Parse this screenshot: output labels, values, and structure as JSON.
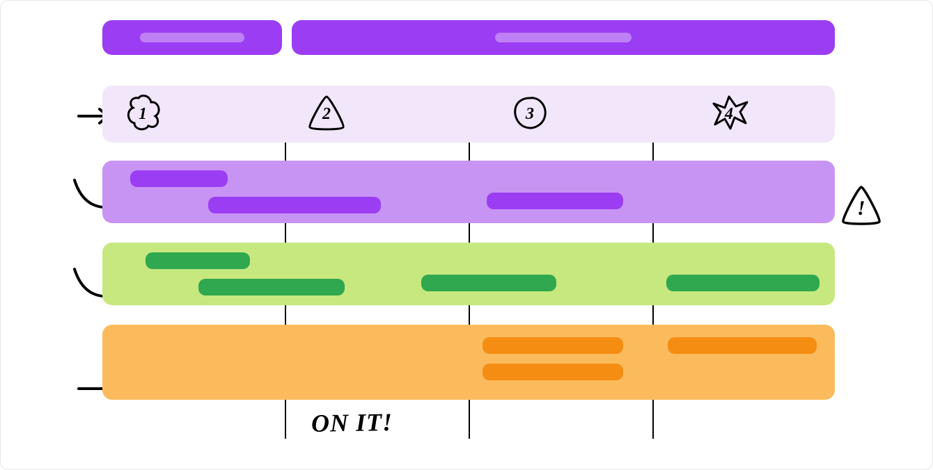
{
  "header": {
    "left_placeholder": "",
    "right_placeholder": ""
  },
  "columns": {
    "labels": [
      "1",
      "2",
      "3",
      "4"
    ]
  },
  "rows": {
    "purple_items": [
      "",
      "",
      ""
    ],
    "green_items": [
      "",
      "",
      "",
      ""
    ],
    "orange_items": [
      "",
      "",
      ""
    ]
  },
  "annotations": {
    "on_it": "ON IT!",
    "warning": "!"
  },
  "colors": {
    "header_bg": "#9b3df2",
    "header_accent": "#bd80f7",
    "light_purple": "#f2e6fb",
    "row_purple_bg": "#c894f3",
    "row_purple_bar": "#9b3df2",
    "row_green_bg": "#c6e87e",
    "row_green_bar": "#2fa84f",
    "row_orange_bg": "#fbbb5c",
    "row_orange_bar": "#f58d13"
  }
}
